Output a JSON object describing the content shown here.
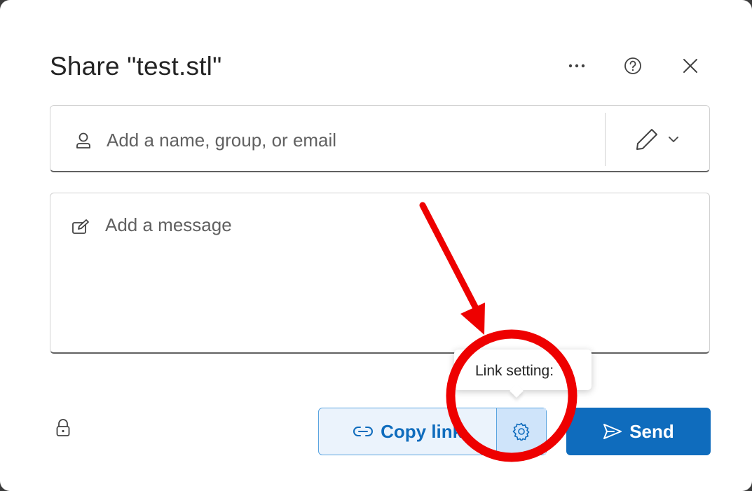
{
  "dialog": {
    "title": "Share \"test.stl\"",
    "more_icon": "more-horizontal-icon",
    "help_icon": "question-circle-icon",
    "close_icon": "close-icon"
  },
  "recipients": {
    "placeholder": "Add a name, group, or email",
    "person_icon": "person-icon",
    "permission_icon": "pencil-icon",
    "permission_dropdown_icon": "chevron-down-icon"
  },
  "message": {
    "placeholder": "Add a message",
    "icon": "compose-icon"
  },
  "footer": {
    "lock_icon": "lock-icon",
    "copy_link_label": "Copy link",
    "copy_link_icon": "link-icon",
    "settings_icon": "gear-icon",
    "send_label": "Send",
    "send_icon": "send-icon"
  },
  "tooltip": {
    "text": "Link setting:"
  },
  "colors": {
    "accent": "#0f6cbd",
    "annotation": "#ee0000"
  }
}
